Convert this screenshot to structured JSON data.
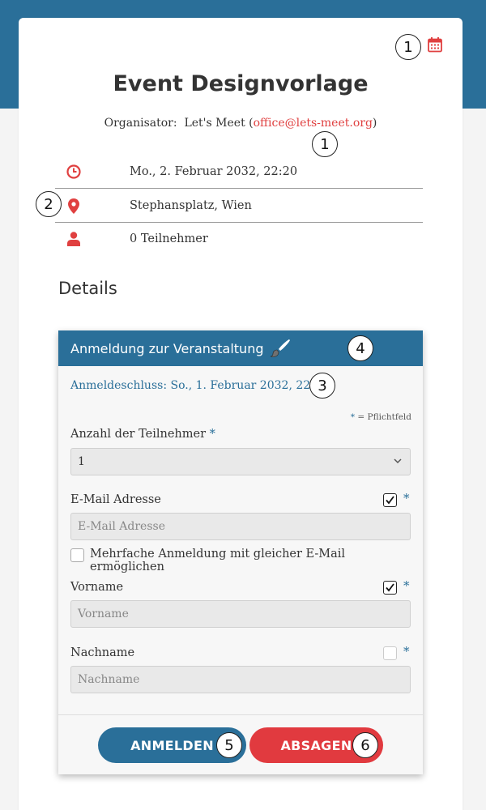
{
  "event": {
    "title": "Event Designvorlage",
    "organizer_prefix": "Organisator:",
    "organizer_name": "Let's Meet",
    "organizer_email": "office@lets-meet.org",
    "date": "Mo., 2. Februar 2032, 22:20",
    "location": "Stephansplatz, Wien",
    "participants": "0 Teilnehmer"
  },
  "section": {
    "details": "Details"
  },
  "form": {
    "header": "Anmeldung zur Veranstaltung",
    "deadline": "Anmeldeschluss: So., 1. Februar 2032, 22:20",
    "required_star": "*",
    "required_note": "= Pflichtfeld",
    "count_label": "Anzahl der Teilnehmer",
    "count_value": "1",
    "email_label": "E-Mail Adresse",
    "email_placeholder": "E-Mail Adresse",
    "email_required_checked": true,
    "multi_label": "Mehrfache Anmeldung mit gleicher E-Mail ermöglichen",
    "multi_checked": false,
    "firstname_label": "Vorname",
    "firstname_placeholder": "Vorname",
    "firstname_required_checked": true,
    "lastname_label": "Nachname",
    "lastname_placeholder": "Nachname",
    "lastname_required_checked": false
  },
  "buttons": {
    "register": "ANMELDEN",
    "cancel": "ABSAGEN"
  },
  "badges": {
    "calendar": "1",
    "email": "1",
    "location": "2",
    "deadline": "3",
    "header": "4",
    "register": "5",
    "cancel": "6"
  },
  "colors": {
    "primary": "#2a6f99",
    "accent": "#e13a3f",
    "icon_red": "#e04040"
  },
  "icons": {
    "calendar": "calendar-icon",
    "clock": "clock-icon",
    "location": "map-pin-icon",
    "person": "person-icon",
    "brush": "paintbrush-icon",
    "chevron": "chevron-down-icon",
    "checkmark": "checkmark-icon"
  }
}
